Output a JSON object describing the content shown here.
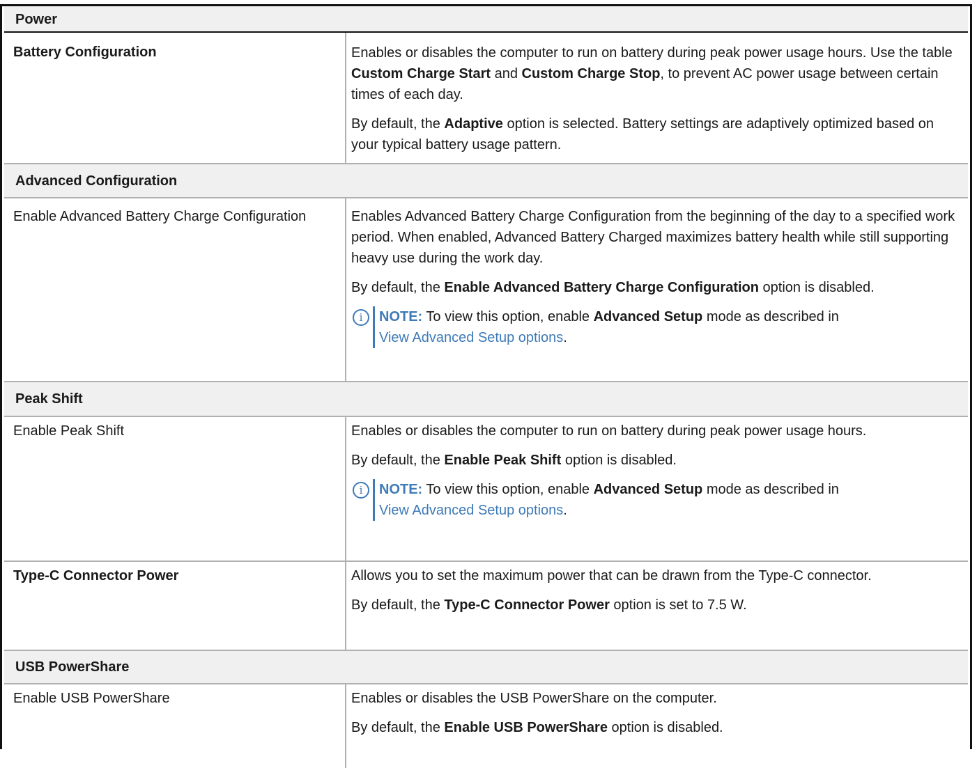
{
  "table": {
    "header": "Power",
    "battery": {
      "title": "Battery Configuration",
      "desc1_a": "Enables or disables the computer to run on battery during peak power usage hours. Use the table ",
      "desc1_b": "Custom Charge Start",
      "desc1_c": " and ",
      "desc1_d": "Custom Charge Stop",
      "desc1_e": ", to prevent AC power usage between certain times of each day.",
      "desc2_a": "By default, the ",
      "desc2_b": "Adaptive",
      "desc2_c": " option is selected. Battery settings are adaptively optimized based on your typical battery usage pattern."
    },
    "advanced": {
      "section": "Advanced Configuration",
      "label": "Enable Advanced Battery Charge Configuration",
      "desc1": "Enables Advanced Battery Charge Configuration from the beginning of the day to a specified work period. When enabled, Advanced Battery Charged maximizes battery health while still supporting heavy use during the work day.",
      "desc2_a": "By default, the ",
      "desc2_b": "Enable Advanced Battery Charge Configuration",
      "desc2_c": " option is disabled.",
      "note_label": "NOTE:",
      "note_a": " To view this option, enable ",
      "note_b": "Advanced Setup",
      "note_c": " mode as described in ",
      "note_link": "View Advanced Setup options",
      "note_end": "."
    },
    "peak": {
      "section": "Peak Shift",
      "label": "Enable Peak Shift",
      "desc1": "Enables or disables the computer to run on battery during peak power usage hours.",
      "desc2_a": "By default, the ",
      "desc2_b": "Enable Peak Shift",
      "desc2_c": " option is disabled.",
      "note_label": "NOTE:",
      "note_a": " To view this option, enable ",
      "note_b": "Advanced Setup",
      "note_c": " mode as described in ",
      "note_link": "View Advanced Setup options",
      "note_end": "."
    },
    "typec": {
      "title": "Type-C Connector Power",
      "desc1": "Allows you to set the maximum power that can be drawn from the Type-C connector.",
      "desc2_a": "By default, the ",
      "desc2_b": "Type-C Connector Power",
      "desc2_c": " option is set to 7.5 W."
    },
    "usb": {
      "section": "USB PowerShare",
      "label": "Enable USB PowerShare",
      "desc1": "Enables or disables the USB PowerShare on the computer.",
      "desc2_a": "By default, the ",
      "desc2_b": "Enable USB PowerShare",
      "desc2_c": " option is disabled."
    }
  },
  "icons": {
    "note": "info-icon"
  },
  "colors": {
    "note_accent": "#3e7ab8",
    "section_bg": "#f0f0f0"
  }
}
